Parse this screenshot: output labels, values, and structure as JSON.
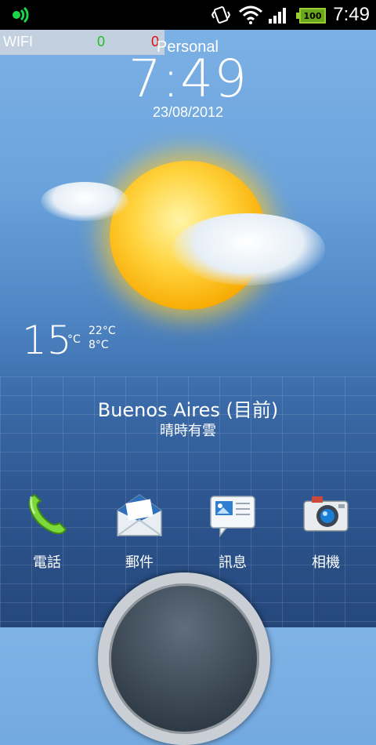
{
  "statusbar": {
    "time": "7:49",
    "battery": "100"
  },
  "wifi_overlay": {
    "label": "WIFI",
    "value_green": "0",
    "value_red": "0"
  },
  "lockscreen": {
    "carrier": "Personal",
    "time": "7:49",
    "date": "23/08/2012"
  },
  "weather": {
    "temp": "15",
    "unit": "°C",
    "high": "22°C",
    "low": "8°C",
    "city": "Buenos Aires (目前)",
    "condition": "晴時有雲"
  },
  "dock": [
    {
      "label": "電話"
    },
    {
      "label": "郵件"
    },
    {
      "label": "訊息"
    },
    {
      "label": "相機"
    }
  ],
  "colors": {
    "wifi_green": "#22c022",
    "wifi_red": "#e01010",
    "battery_green": "#6aa61f"
  }
}
